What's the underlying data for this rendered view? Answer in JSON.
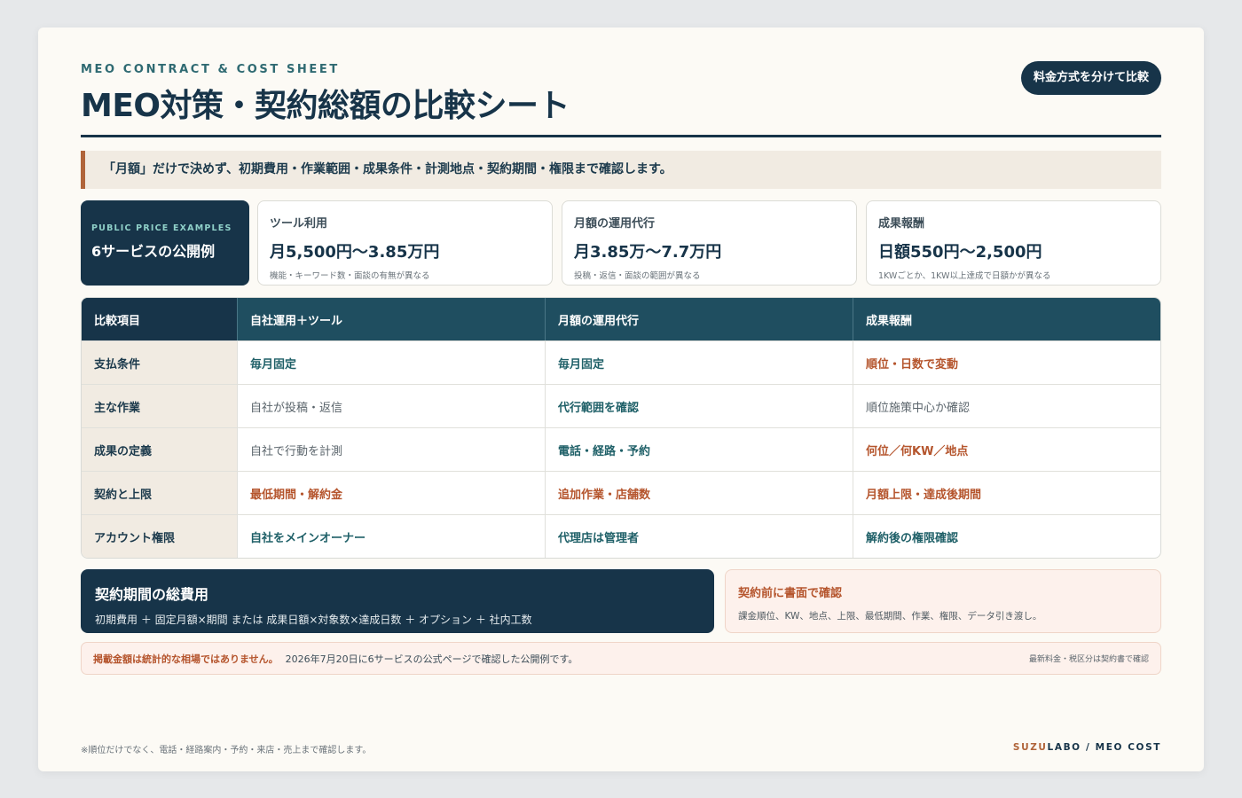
{
  "header": {
    "eyebrow": "MEO CONTRACT & COST SHEET",
    "title": "MEO対策・契約総額の比較シート",
    "pill": "料金方式を分けて比較"
  },
  "notice": "「月額」だけで決めず、初期費用・作業範囲・成果条件・計測地点・契約期間・権限まで確認します。",
  "prices": {
    "kicker": "PUBLIC PRICE EXAMPLES",
    "title": "6サービスの公開例",
    "cards": [
      {
        "label": "ツール利用",
        "price": "月5,500円〜3.85万円",
        "note": "機能・キーワード数・面談の有無が異なる"
      },
      {
        "label": "月額の運用代行",
        "price": "月3.85万〜7.7万円",
        "note": "投稿・返信・面談の範囲が異なる"
      },
      {
        "label": "成果報酬",
        "price": "日額550円〜2,500円",
        "note": "1KWごとか、1KW以上達成で日額かが異なる"
      }
    ]
  },
  "table": {
    "headers": [
      "比較項目",
      "自社運用＋ツール",
      "月額の運用代行",
      "成果報酬"
    ],
    "rows": [
      {
        "label": "支払条件",
        "cells": [
          "毎月固定",
          "毎月固定",
          "順位・日数で変動"
        ]
      },
      {
        "label": "主な作業",
        "cells": [
          "自社が投稿・返信",
          "代行範囲を確認",
          "順位施策中心か確認"
        ]
      },
      {
        "label": "成果の定義",
        "cells": [
          "自社で行動を計測",
          "電話・経路・予約",
          "何位／何KW／地点"
        ]
      },
      {
        "label": "契約と上限",
        "cells": [
          "最低期間・解約金",
          "追加作業・店舗数",
          "月額上限・達成後期間"
        ]
      },
      {
        "label": "アカウント権限",
        "cells": [
          "自社をメインオーナー",
          "代理店は管理者",
          "解約後の権限確認"
        ]
      }
    ]
  },
  "total": {
    "title": "契約期間の総費用",
    "formula": "初期費用 ＋ 固定月額×期間 または 成果日額×対象数×達成日数 ＋ オプション ＋ 社内工数"
  },
  "check": {
    "title": "契約前に書面で確認",
    "text": "課金順位、KW、地点、上限、最低期間、作業、権限、データ引き渡し。"
  },
  "disclaimer": {
    "bold": "掲載金額は統計的な相場ではありません。",
    "text": "2026年7月20日に6サービスの公式ページで確認した公開例です。",
    "right": "最新料金・税区分は契約書で確認"
  },
  "footer": {
    "note": "※順位だけでなく、電話・経路案内・予約・来店・売上まで確認します。",
    "brand_accent": "SUZU",
    "brand_rest": "LABO / MEO COST"
  }
}
